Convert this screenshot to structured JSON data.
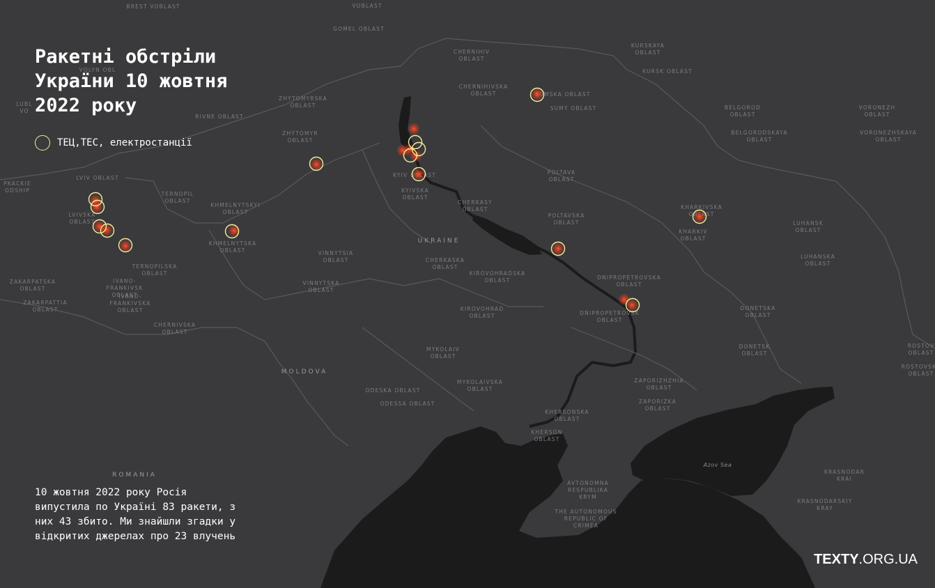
{
  "title": "Ракетні обстріли\nУкраїни 10 жовтня\n2022 року",
  "legend": {
    "label": "ТЕЦ,ТЕС, електростанції",
    "circle_color": "#f3ec9a"
  },
  "description": "10 жовтня 2022 року Росія випустила по Україні 83 ракети, з них 43 збито. Ми знайшли згадки у відкритих джерелах про 23 влучень",
  "brand": {
    "name": "TEXTY",
    "domain": ".ORG.UA"
  },
  "colors": {
    "land": "#3a3a3c",
    "sea": "#1b1b1c",
    "border": "#5a5a5e",
    "hit": "#ff3d1a"
  },
  "labels": [
    {
      "text": "BREST VOBLAST"
    },
    {
      "text": "VOBLAST"
    },
    {
      "text": "GOMEL OBLAST"
    },
    {
      "text": "CHERNIHIV\nOBLAST"
    },
    {
      "text": "KURSKAYA\nOBLAST"
    },
    {
      "text": "KURSK OBLAST"
    },
    {
      "text": "VOLYN OBL"
    },
    {
      "text": "CHERNIHIVSKA\nOBLAST"
    },
    {
      "text": "SUMSKA OBLAST"
    },
    {
      "text": "SUMY OBLAST"
    },
    {
      "text": "ZHYTOMYRSKA\nOBLAST"
    },
    {
      "text": "RIVNE OBLAST"
    },
    {
      "text": "BELGOROD\nOBLAST"
    },
    {
      "text": "VORONEZH\nOBLAST"
    },
    {
      "text": "BELGORODSKAYA\nOBLAST"
    },
    {
      "text": "VORONEZHSKAYA\nOBLAST"
    },
    {
      "text": "ZHYTOMYR\nOBLAST"
    },
    {
      "text": "POLTAVA\nOBLAST"
    },
    {
      "text": "LVIV OBLAST"
    },
    {
      "text": "KYIV OBLAST"
    },
    {
      "text": "KYIVSKA\nOBLAST"
    },
    {
      "text": "TERNOPIL\nOBLAST"
    },
    {
      "text": "KHMELNYTSKYI\nOBLAST"
    },
    {
      "text": "CHERKASY\nOBLAST"
    },
    {
      "text": "KHARKIVSKA\nOBLAST"
    },
    {
      "text": "POLTAVSKA\nOBLAST"
    },
    {
      "text": "LVIVSKA\nOBLAST"
    },
    {
      "text": "KHARKIV\nOBLAST"
    },
    {
      "text": "LUHANSK\nOBLAST"
    },
    {
      "text": "KHMELNYTSKA\nOBLAST"
    },
    {
      "text": "TERNOPILSKA\nOBLAST"
    },
    {
      "text": "VINNYTSIA\nOBLAST"
    },
    {
      "text": "CHERKASKA\nOBLAST"
    },
    {
      "text": "LUHANSKA\nOBLAST"
    },
    {
      "text": "ZAKARPATSKA\nOBLAST"
    },
    {
      "text": "IVANO-\nFRANKIVSK\nOBLAST"
    },
    {
      "text": "VINNYTSKA\nOBLAST"
    },
    {
      "text": "KIROVOHRADSKA\nOBLAST"
    },
    {
      "text": "DNIPROPETROVSKA\nOBLAST"
    },
    {
      "text": "ZAKARPATTIA\nOBLAST"
    },
    {
      "text": "IVANO-\nFRANKIVSKA\nOBLAST"
    },
    {
      "text": "KIROVOHRAD\nOBLAST"
    },
    {
      "text": "DNIPROPETROVSK\nOBLAST"
    },
    {
      "text": "DONETSKA\nOBLAST"
    },
    {
      "text": "CHERNIVSKA\nOBLAST"
    },
    {
      "text": "MYKOLAIV\nOBLAST"
    },
    {
      "text": "DONETSK\nOBLAST"
    },
    {
      "text": "ROSTOV\nOBLAST"
    },
    {
      "text": "MYKOLAIVSKA\nOBLAST"
    },
    {
      "text": "ODESKA OBLAST"
    },
    {
      "text": "ODESSA OBLAST"
    },
    {
      "text": "ZAPORIZHZHIA\nOBLAST"
    },
    {
      "text": "ZAPORIZKA\nOBLAST"
    },
    {
      "text": "KHERSONSKA\nOBLAST"
    },
    {
      "text": "KHERSON\nOBLAST"
    },
    {
      "text": "KRASNODAR\nKRAI"
    },
    {
      "text": "AVTONOMNA\nRESPUBLIKA\nKRYM"
    },
    {
      "text": "KRASNODARSKIY\nKRAY"
    },
    {
      "text": "THE AUTONOMOUS\nREPUBLIC OF\nCRIMEA"
    },
    {
      "text": "ROSTOVSKA\nOBLAST"
    },
    {
      "text": "LUBL\nVO"
    },
    {
      "text": "PKACKIE\nODSHIP"
    },
    {
      "text": "UKRAINE",
      "kind": "country"
    },
    {
      "text": "MOLDOVA",
      "kind": "country"
    },
    {
      "text": "ROMANIA",
      "kind": "country"
    },
    {
      "text": "Azov Sea",
      "kind": "sea"
    }
  ]
}
